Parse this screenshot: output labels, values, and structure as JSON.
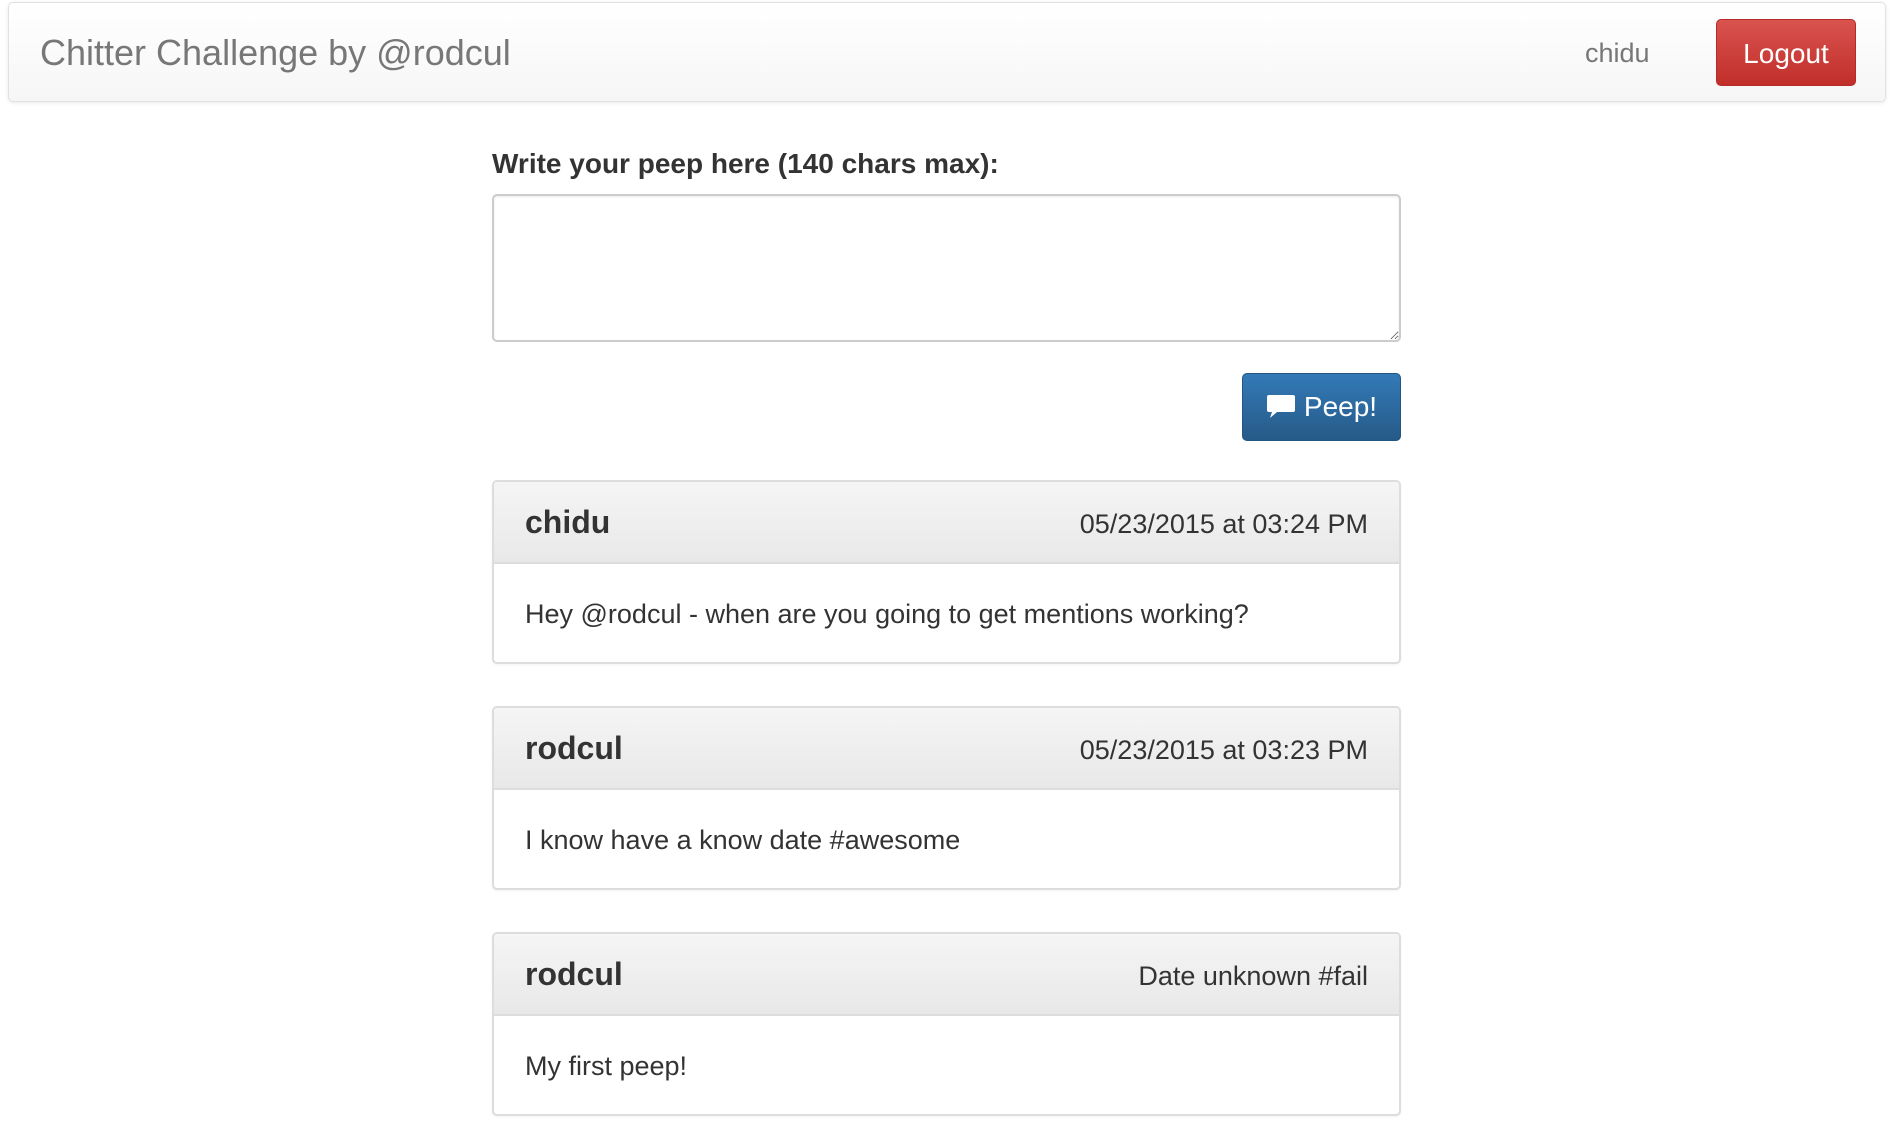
{
  "navbar": {
    "brand": "Chitter Challenge by @rodcul",
    "username": "chidu",
    "logout_label": "Logout"
  },
  "compose": {
    "label": "Write your peep here (140 chars max):",
    "textarea_value": "",
    "submit_label": "Peep!",
    "submit_icon": "comment-icon"
  },
  "peeps": [
    {
      "author": "chidu",
      "date": "05/23/2015 at 03:24 PM",
      "message": "Hey @rodcul - when are you going to get mentions working?"
    },
    {
      "author": "rodcul",
      "date": "05/23/2015 at 03:23 PM",
      "message": "I know have a know date #awesome"
    },
    {
      "author": "rodcul",
      "date": "Date unknown #fail",
      "message": "My first peep!"
    }
  ],
  "colors": {
    "danger": "#d9534f",
    "primary": "#337ab7",
    "panel_heading": "#f5f5f5",
    "text": "#333333",
    "muted": "#777777"
  }
}
